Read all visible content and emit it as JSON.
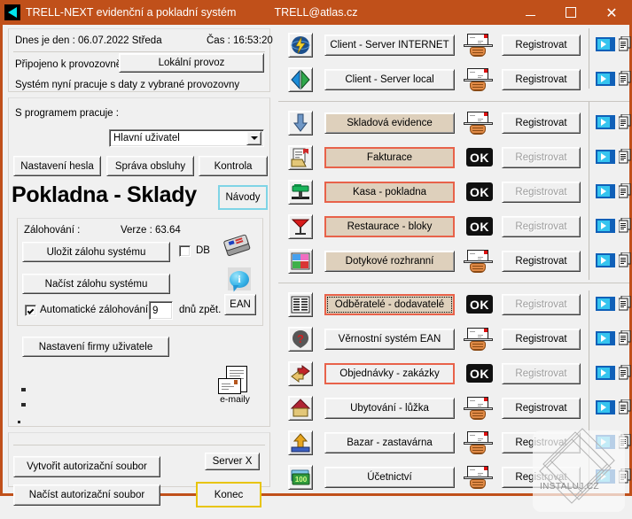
{
  "window": {
    "title": "TRELL-NEXT evidenční a pokladní systém",
    "email": "TRELL@atlas.cz",
    "minimize": "–",
    "maximize": "□",
    "close": "✕",
    "app_icon": "triangle-logo-icon"
  },
  "left": {
    "date_line": "Dnes je den :  06.07.2022  Středa",
    "time_line": "Čas : 16:53:20",
    "connected_label": "Připojeno k provozovně",
    "connected_value": "Lokální  provoz",
    "system_note": "Systém nyní pracuje s daty z vybrané provozovny",
    "user_label": "S programem pracuje :",
    "user_value": "Hlavní uživatel",
    "buttons_row": [
      "Nastavení hesla",
      "Správa obsluhy",
      "Kontrola"
    ],
    "title": "Pokladna - Sklady",
    "manuals_button": "Návody",
    "backup_label": "Zálohování :",
    "version_label": "Verze : 63.64",
    "save_backup": "Uložit zálohu systému",
    "db_checkbox": "DB",
    "db_checked": false,
    "load_backup": "Načíst zálohu systému",
    "auto_backup": "Automatické zálohování",
    "auto_backup_checked": true,
    "auto_backup_days": "9",
    "auto_backup_suffix": "dnů zpět.",
    "company_settings": "Nastavení  firmy  uživatele",
    "email_icon_label": "e-maily",
    "ean_button": "EAN",
    "create_auth": "Vytvořit autorizační soubor",
    "load_auth": "Načíst autorizační soubor",
    "server_button": "Server X",
    "quit_button": "Konec",
    "accent_manuals_border": "#7fd4e6",
    "accent_quit_border": "#e8c40b",
    "accent_registered_border": "#e8624a"
  },
  "right": {
    "register_label": "Registrovat",
    "ok_badge": "OK",
    "mail_icon": "envelope-in-hand-icon",
    "play_icon": "video-play-icon",
    "doc_icon": "document-copy-icon",
    "modules": [
      {
        "name": "Client - Server INTERNET",
        "icon": "globe-bolt-icon",
        "registered": false,
        "highlighted": false,
        "focused": false,
        "separator_after": false
      },
      {
        "name": "Client - Server local",
        "icon": "left-right-arrows-icon",
        "registered": false,
        "highlighted": false,
        "focused": false,
        "separator_after": true
      },
      {
        "name": "Skladová evidence",
        "icon": "down-arrow-icon",
        "registered": false,
        "highlighted": true,
        "focused": false,
        "separator_after": false
      },
      {
        "name": "Fakturace",
        "icon": "invoice-icon",
        "registered": true,
        "highlighted": true,
        "focused": false,
        "separator_after": false
      },
      {
        "name": "Kasa - pokladna",
        "icon": "cash-register-icon",
        "registered": true,
        "highlighted": true,
        "focused": false,
        "separator_after": false
      },
      {
        "name": "Restaurace - bloky",
        "icon": "cocktail-glass-icon",
        "registered": true,
        "highlighted": true,
        "focused": false,
        "separator_after": false
      },
      {
        "name": "Dotykové rozhranní",
        "icon": "color-tiles-icon",
        "registered": false,
        "highlighted": true,
        "focused": false,
        "separator_after": true
      },
      {
        "name": "Odběratelé - dodavatelé",
        "icon": "list-lines-icon",
        "registered": true,
        "highlighted": true,
        "focused": true,
        "separator_after": false
      },
      {
        "name": "Věrnostní systém EAN",
        "icon": "question-mark-icon",
        "registered": false,
        "highlighted": false,
        "focused": false,
        "separator_after": false
      },
      {
        "name": "Objednávky - zakázky",
        "icon": "arrows-exchange-icon",
        "registered": true,
        "highlighted": false,
        "focused": false,
        "separator_after": false
      },
      {
        "name": "Ubytování - lůžka",
        "icon": "house-icon",
        "registered": false,
        "highlighted": false,
        "focused": false,
        "separator_after": false
      },
      {
        "name": "Bazar - zastavárna",
        "icon": "up-arrow-box-icon",
        "registered": false,
        "highlighted": false,
        "focused": false,
        "separator_after": false
      },
      {
        "name": "Účetnictví",
        "icon": "money-100-icon",
        "registered": false,
        "highlighted": false,
        "focused": false,
        "separator_after": false
      }
    ]
  },
  "watermark": {
    "text": "INSTALUJ.CZ"
  }
}
